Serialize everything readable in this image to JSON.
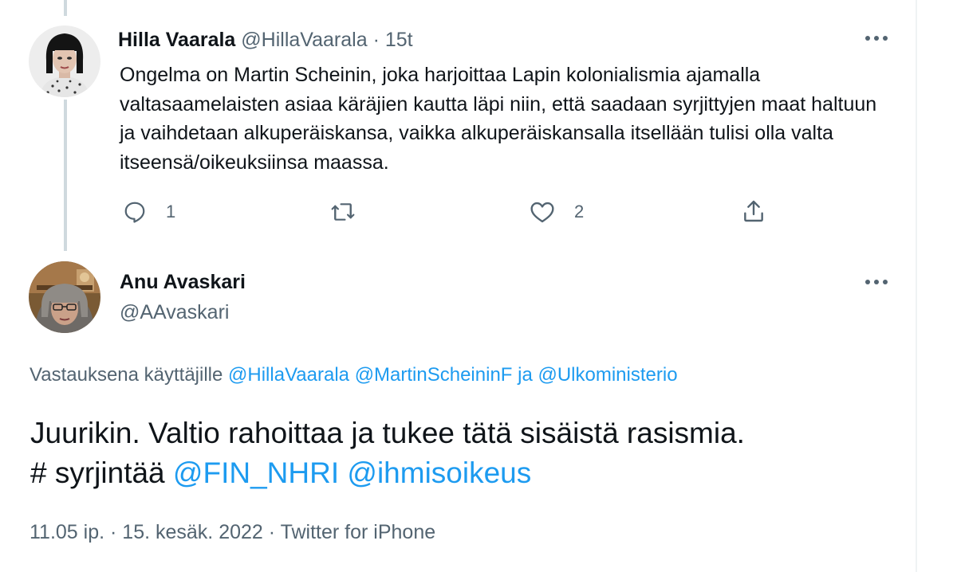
{
  "parent_tweet": {
    "display_name": "Hilla Vaarala",
    "handle": "@HillaVaarala",
    "separator": "·",
    "time": "15t",
    "text": "Ongelma on Martin Scheinin, joka harjoittaa Lapin kolonialismia ajamalla valtasaamelaisten asiaa käräjien kautta läpi niin, että saadaan syrjittyjen maat haltuun ja vaihdetaan alkuperäiskansa, vaikka alkuperäiskansalla itsellään tulisi olla valta itseensä/oikeuksiinsa maassa.",
    "actions": {
      "reply_count": "1",
      "retweet_count": "",
      "like_count": "2"
    },
    "icons": [
      "reply-icon",
      "retweet-icon",
      "like-icon",
      "share-icon",
      "more-icon"
    ]
  },
  "main_tweet": {
    "display_name": "Anu Avaskari",
    "handle": "@AAvaskari",
    "reply_prefix": "Vastauksena käyttäjille",
    "reply_users": [
      "@HillaVaarala",
      "@MartinScheininF"
    ],
    "reply_and": "ja",
    "reply_last_user": "@Ulkoministerio",
    "text_line1": "Juurikin. Valtio rahoittaa ja tukee tätä sisäistä rasismia.",
    "hashtag": "# syrjintää",
    "mentions": [
      "@FIN_NHRI",
      "@ihmisoikeus"
    ],
    "time": "11.05 ip.",
    "dot": "·",
    "date": "15. kesäk. 2022",
    "source": "Twitter for iPhone"
  },
  "colors": {
    "link": "#1d9bf0",
    "muted": "#536471",
    "text": "#0f1419",
    "thread_line": "#cfd9de"
  }
}
